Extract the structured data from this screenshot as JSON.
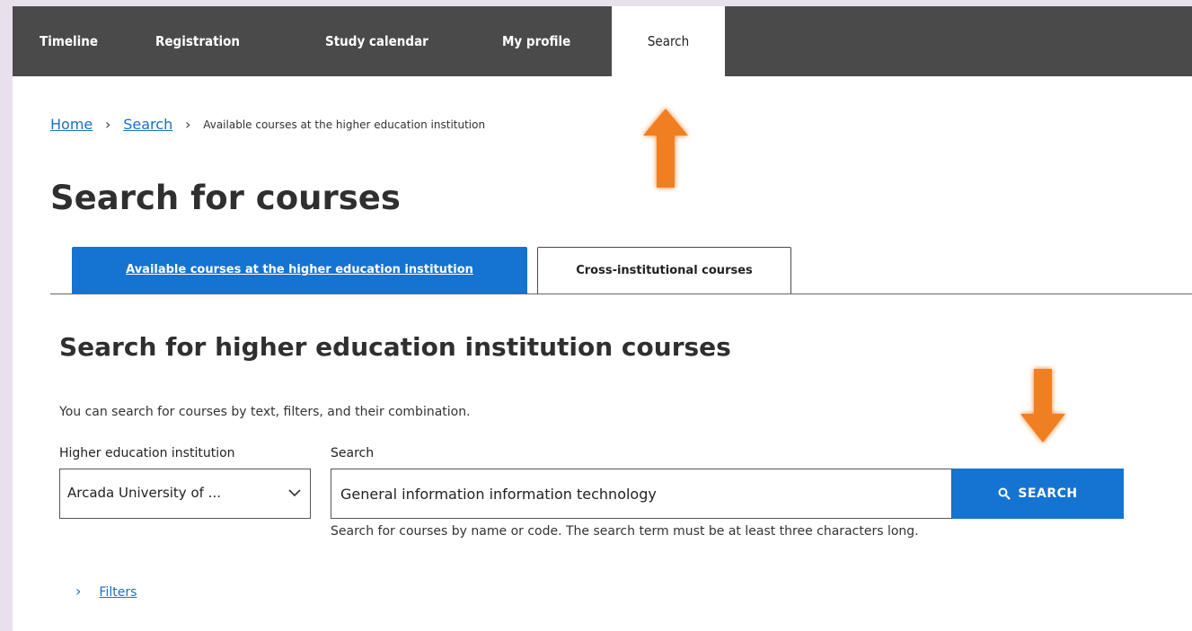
{
  "nav": {
    "items": [
      {
        "label": "Timeline"
      },
      {
        "label": "Registration"
      },
      {
        "label": "Study calendar"
      },
      {
        "label": "My profile"
      },
      {
        "label": "Search",
        "active": true
      }
    ]
  },
  "breadcrumb": {
    "home": "Home",
    "search": "Search",
    "current": "Available courses at the higher education institution"
  },
  "page_title": "Search for courses",
  "tabs": [
    {
      "label": "Available courses at the higher education institution",
      "active": true
    },
    {
      "label": "Cross-institutional courses",
      "active": false
    }
  ],
  "section": {
    "title": "Search for higher education institution courses",
    "intro": "You can search for courses by text, filters, and their combination."
  },
  "form": {
    "institution_label": "Higher education institution",
    "institution_value": "Arcada University of ...",
    "search_label": "Search",
    "search_value": "General information information technology",
    "search_button": "SEARCH",
    "help_text": "Search for courses by name or code. The search term must be at least three characters long."
  },
  "filters": {
    "label": "Filters"
  },
  "annotations": {
    "arrow_color": "#f07f22"
  },
  "colors": {
    "primary": "#1573d1",
    "nav_bg": "#4a4a4a",
    "link": "#1a6fc4"
  }
}
